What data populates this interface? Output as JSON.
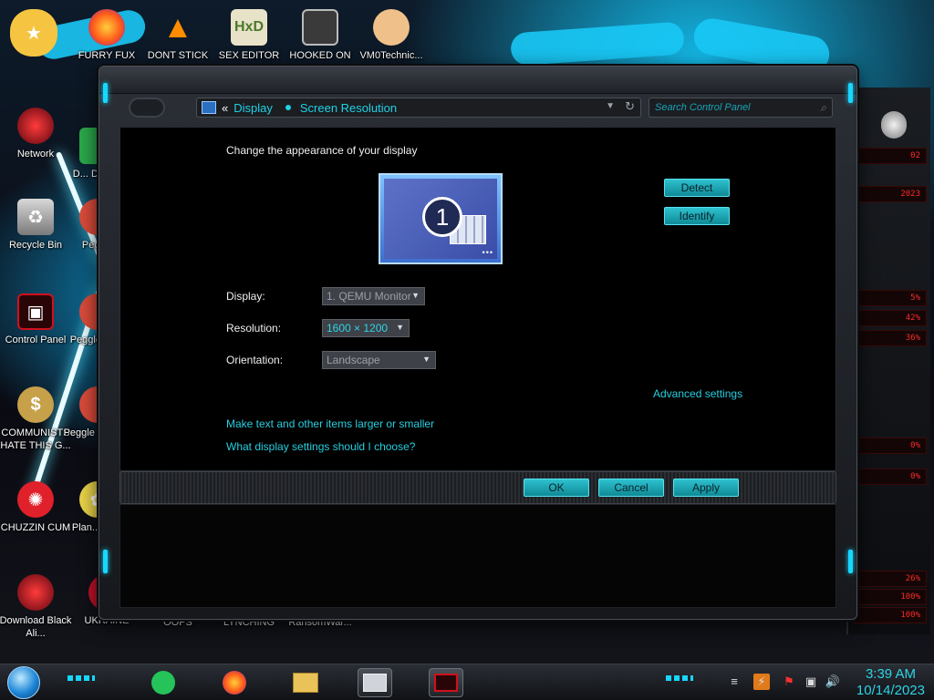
{
  "desktop": {
    "icons": [
      {
        "label": "",
        "icon": "star-butterfly-icon",
        "color": "#f5c542"
      },
      {
        "label": "FURRY FUX",
        "icon": "firefox-icon",
        "color": "#ff7a1a"
      },
      {
        "label": "DONT STICK",
        "icon": "vlc-cone-icon",
        "color": "#ff8c00"
      },
      {
        "label": "SEX EDITOR",
        "icon": "hxd-icon",
        "color": "#c8b14a"
      },
      {
        "label": "HOOKED ON",
        "icon": "maze-icon",
        "color": "#5a5a5a"
      },
      {
        "label": "VM0Technic...",
        "icon": "doctor-icon",
        "color": "#f0c08a"
      },
      {
        "label": "Network",
        "icon": "network-orb-icon",
        "color": "#8a0c1a"
      },
      {
        "label": "D... DUM...",
        "icon": "game-icon",
        "color": "#2aa84a"
      },
      {
        "label": "Recycle Bin",
        "icon": "recycle-bin-icon",
        "color": "#b8b8b8"
      },
      {
        "label": "Peggle",
        "icon": "peggle-icon",
        "color": "#d94b3a"
      },
      {
        "label": "Control Panel",
        "icon": "control-panel-icon",
        "color": "#b0101c"
      },
      {
        "label": "Peggle De...",
        "icon": "peggle-deluxe-icon",
        "color": "#d94b3a"
      },
      {
        "label": "COMMUNISTS HATE THIS G...",
        "icon": "money-bag-icon",
        "color": "#c7a04a"
      },
      {
        "label": "Peggle of Wa...",
        "icon": "peggle-wa-icon",
        "color": "#d94b3a"
      },
      {
        "label": "CHUZZIN CUM",
        "icon": "chuzzle-icon",
        "color": "#e0202a"
      },
      {
        "label": "Plan... Zo...",
        "icon": "plants-zombies-icon",
        "color": "#e8d24a"
      },
      {
        "label": "Download Black Ali...",
        "icon": "alien-orb-icon",
        "color": "#8a0c1a"
      },
      {
        "label": "UKRAINE",
        "icon": "ukraine-icon",
        "color": "#c2122a"
      },
      {
        "label": "OOPS",
        "icon": "",
        "color": ""
      },
      {
        "label": "LYNCHING",
        "icon": "",
        "color": ""
      },
      {
        "label": "RansomWar...",
        "icon": "",
        "color": ""
      }
    ]
  },
  "gadget": {
    "readouts": [
      "02",
      "2023",
      "5%",
      "42%",
      "36%",
      "0%",
      "0%",
      "26%",
      "100%",
      "100%"
    ]
  },
  "window": {
    "address": {
      "separator": "«",
      "crumbs": [
        "Display",
        "Screen Resolution"
      ]
    },
    "search": {
      "placeholder": "Search Control Panel"
    },
    "heading": "Change the appearance of your display",
    "monitor_number": "1",
    "buttons": {
      "detect": "Detect",
      "identify": "Identify",
      "ok": "OK",
      "cancel": "Cancel",
      "apply": "Apply"
    },
    "fields": {
      "display": {
        "label": "Display:",
        "value": "1. QEMU Monitor"
      },
      "resolution": {
        "label": "Resolution:",
        "value": "1600 × 1200"
      },
      "orientation": {
        "label": "Orientation:",
        "value": "Landscape"
      }
    },
    "links": {
      "advanced": "Advanced settings",
      "text_size": "Make text and other items larger or smaller",
      "help": "What display settings should I choose?"
    }
  },
  "taskbar": {
    "pinned": [
      {
        "icon": "notepad-icon"
      },
      {
        "icon": "firefox-icon"
      },
      {
        "icon": "file-explorer-icon"
      },
      {
        "icon": "screen-resolution-icon"
      },
      {
        "icon": "control-panel-icon"
      }
    ],
    "clock": {
      "time": "3:39 AM",
      "date": "10/14/2023"
    }
  },
  "colors": {
    "accent": "#1fd2e6",
    "button": "#1aa8b5",
    "alert_red": "#ff2a2a"
  }
}
